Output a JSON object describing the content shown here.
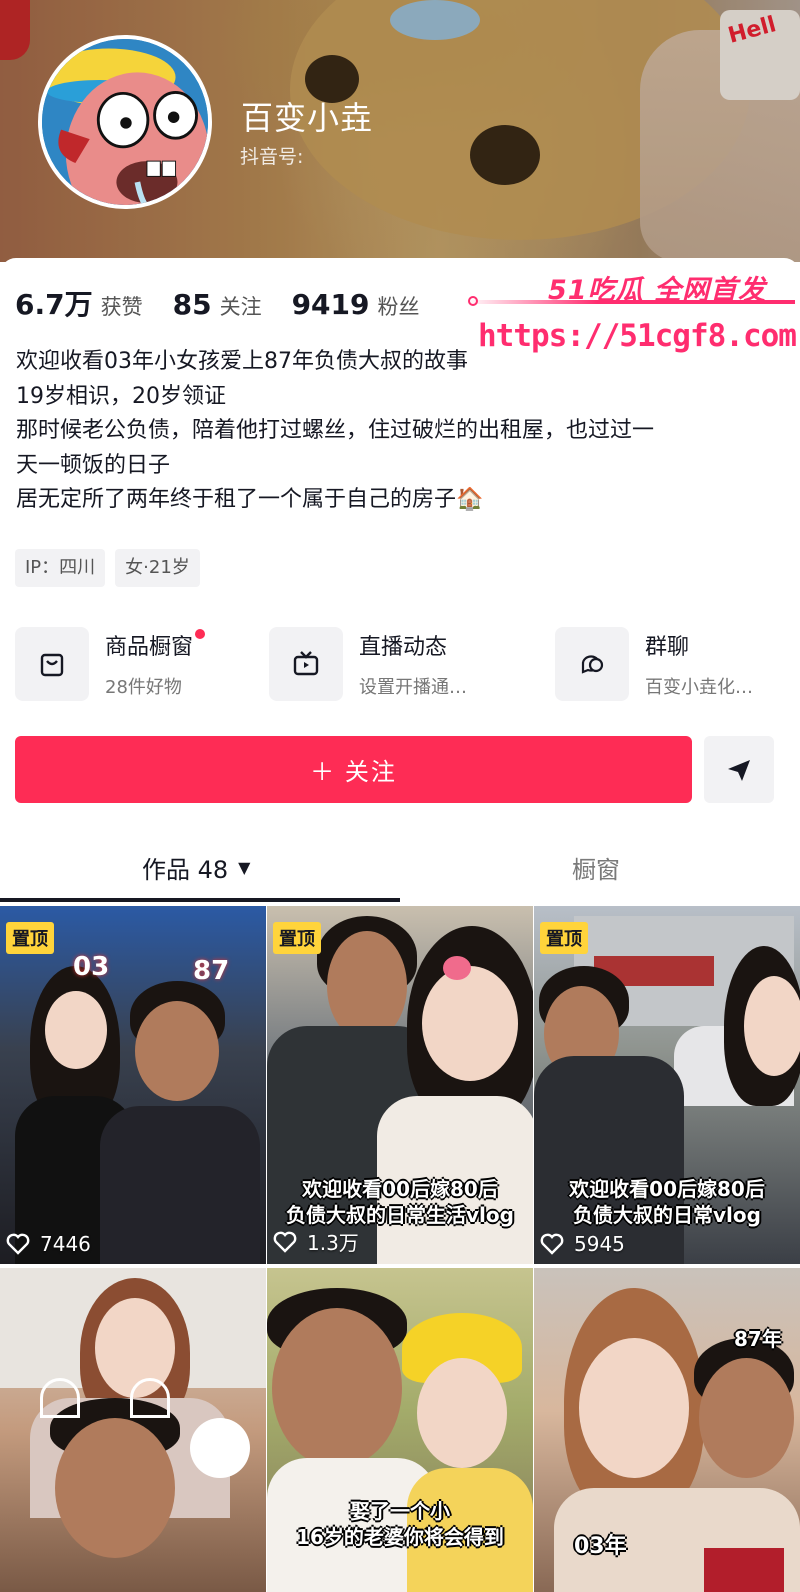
{
  "profile": {
    "name": "百变小垚",
    "douyin_id_label": "抖音号:"
  },
  "stats": [
    {
      "value": "6.7万",
      "label": "获赞"
    },
    {
      "value": "85",
      "label": "关注"
    },
    {
      "value": "9419",
      "label": "粉丝"
    }
  ],
  "watermark": {
    "brand": "51吃瓜 全网首发",
    "url": "https://51cgf8.com"
  },
  "bio": [
    "欢迎收看03年小女孩爱上87年负债大叔的故事",
    "19岁相识，20岁领证",
    "那时候老公负债，陪着他打过螺丝，住过破烂的出租屋，也过过一",
    "天一顿饭的日子",
    "居无定所了两年终于租了一个属于自己的房子🏠"
  ],
  "tags": [
    "IP：四川",
    "女·21岁"
  ],
  "shortcuts": [
    {
      "title": "商品橱窗",
      "subtitle": "28件好物",
      "icon": "shopping-bag-icon",
      "has_dot": true
    },
    {
      "title": "直播动态",
      "subtitle": "设置开播通…",
      "icon": "live-tv-icon",
      "has_dot": false
    },
    {
      "title": "群聊",
      "subtitle": "百变小垚化…",
      "icon": "chat-bubbles-icon",
      "has_dot": false
    }
  ],
  "follow": {
    "label": "＋ 关注",
    "share_icon": "send-arrow-icon"
  },
  "tabs": {
    "works_label": "作品 48",
    "window_label": "橱窗"
  },
  "videos": [
    {
      "pinned": true,
      "pin_label": "置顶",
      "likes": "7446",
      "caption": "",
      "overlay_left": "03",
      "overlay_right": "87"
    },
    {
      "pinned": true,
      "pin_label": "置顶",
      "likes": "1.3万",
      "caption": "欢迎收看00后嫁80后\n负债大叔的日常生活vlog",
      "overlay_left": "",
      "overlay_right": ""
    },
    {
      "pinned": true,
      "pin_label": "置顶",
      "likes": "5945",
      "caption": "欢迎收看00后嫁80后\n负债大叔的日常vlog",
      "overlay_left": "",
      "overlay_right": ""
    },
    {
      "pinned": false,
      "pin_label": "",
      "likes": "",
      "caption": "",
      "overlay_left": "",
      "overlay_right": ""
    },
    {
      "pinned": false,
      "pin_label": "",
      "likes": "",
      "caption": "娶了一个小\n16岁的老婆你将会得到",
      "overlay_left": "",
      "overlay_right": ""
    },
    {
      "pinned": false,
      "pin_label": "",
      "likes": "",
      "caption": "",
      "overlay_left": "03年",
      "overlay_right": "87年"
    }
  ],
  "colors": {
    "accent": "#fe2c55",
    "pin": "#ffd43b",
    "watermark": "#ff2d6f"
  }
}
